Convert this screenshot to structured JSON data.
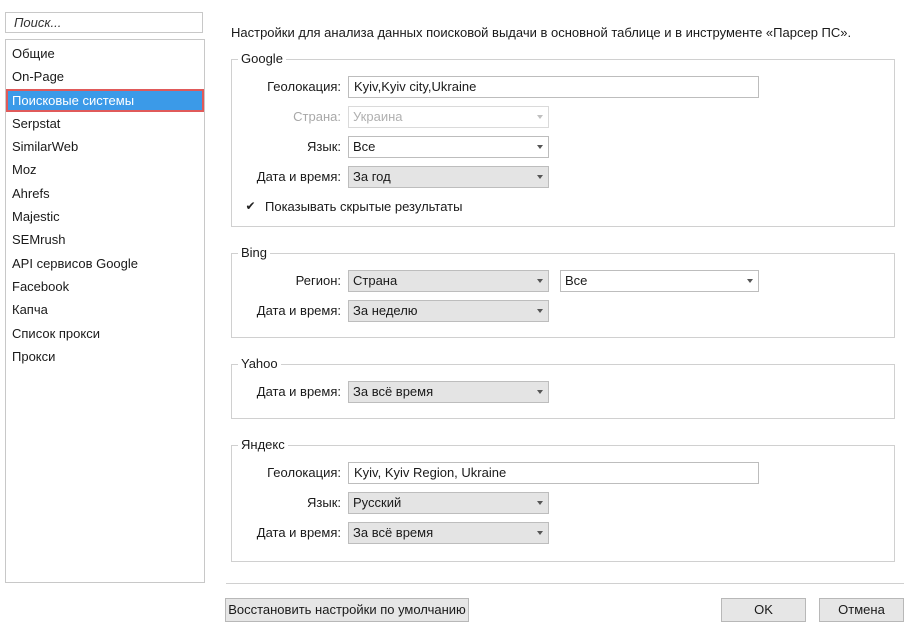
{
  "search": {
    "placeholder": "Поиск..."
  },
  "sidebar": {
    "items": [
      {
        "label": "Общие"
      },
      {
        "label": "On-Page"
      },
      {
        "label": "Поисковые системы",
        "active": true
      },
      {
        "label": "Serpstat"
      },
      {
        "label": "SimilarWeb"
      },
      {
        "label": "Moz"
      },
      {
        "label": "Ahrefs"
      },
      {
        "label": "Majestic"
      },
      {
        "label": "SEMrush"
      },
      {
        "label": "API сервисов Google"
      },
      {
        "label": "Facebook"
      },
      {
        "label": "Капча"
      },
      {
        "label": "Список прокси"
      },
      {
        "label": "Прокси"
      }
    ]
  },
  "intro": "Настройки для анализа данных поисковой выдачи в основной таблице и в инструменте «Парсер ПС».",
  "google": {
    "title": "Google",
    "geo_label": "Геолокация:",
    "geo_value": "Kyiv,Kyiv city,Ukraine",
    "country_label": "Страна:",
    "country_value": "Украина",
    "lang_label": "Язык:",
    "lang_value": "Все",
    "date_label": "Дата и время:",
    "date_value": "За год",
    "hidden_label": "Показывать скрытые результаты",
    "hidden_checked": true
  },
  "bing": {
    "title": "Bing",
    "region_label": "Регион:",
    "region_value": "Страна",
    "region2_value": "Все",
    "date_label": "Дата и время:",
    "date_value": "За неделю"
  },
  "yahoo": {
    "title": "Yahoo",
    "date_label": "Дата и время:",
    "date_value": "За всё время"
  },
  "yandex": {
    "title": "Яндекс",
    "geo_label": "Геолокация:",
    "geo_value": "Kyiv, Kyiv Region, Ukraine",
    "lang_label": "Язык:",
    "lang_value": "Русский",
    "date_label": "Дата и время:",
    "date_value": "За всё время"
  },
  "footer": {
    "reset_label": "Восстановить настройки по умолчанию",
    "ok_label": "OK",
    "cancel_label": "Отмена"
  },
  "colors": {
    "accent": "#3b9ae8",
    "highlight_border": "#e05a5a"
  },
  "icons": {
    "dropdown": "chevron-down-icon",
    "check": "check-icon"
  }
}
